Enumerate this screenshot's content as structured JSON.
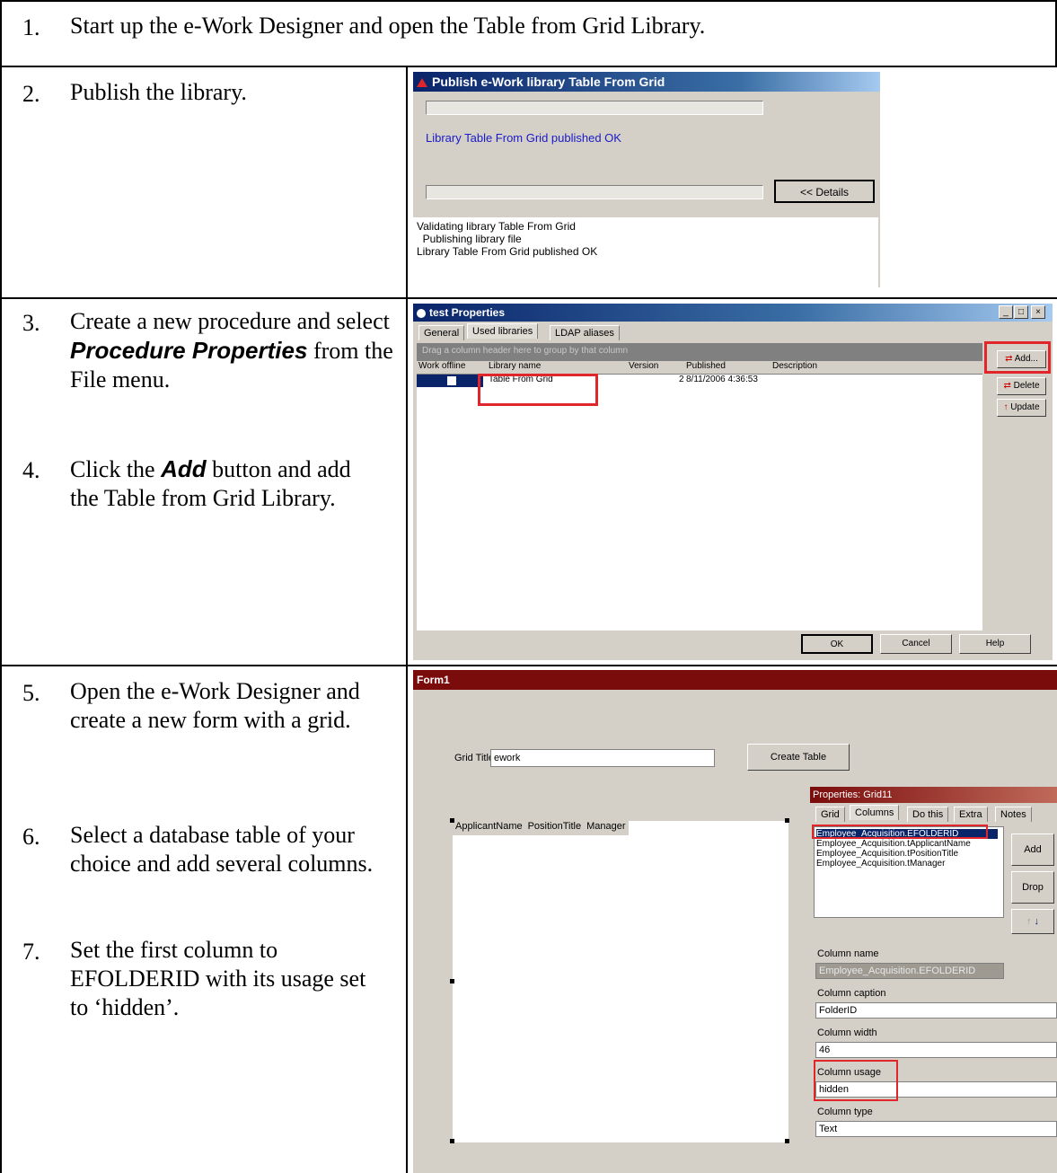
{
  "steps": [
    {
      "num": "1.",
      "text": "Start up the e-Work Designer and open the Table from Grid Library."
    },
    {
      "num": "2.",
      "text": "Publish the library."
    },
    {
      "num": "3.",
      "text_a": "Create a new procedure and select ",
      "bold": "Procedure Properties",
      "text_b": " from the File menu."
    },
    {
      "num": "4.",
      "text_a": "Click the ",
      "bold": "Add",
      "text_b": " button and add the Table from Grid Library."
    },
    {
      "num": "5.",
      "text": "Open the e-Work Designer and create a new form with a grid."
    },
    {
      "num": "6.",
      "text": "Select a database table of your choice and add several columns."
    },
    {
      "num": "7.",
      "text": "Set the first column to EFOLDERID with its usage set to ‘hidden’."
    }
  ],
  "publish_dialog": {
    "title": "Publish e-Work library Table From Grid",
    "status": "Library Table From Grid published OK",
    "details_button": "<< Details",
    "log": [
      "Validating library  Table From Grid",
      "  Publishing library file",
      "Library Table From Grid published OK"
    ]
  },
  "properties_dialog": {
    "title": "test Properties",
    "tabs": [
      "General",
      "Used libraries",
      "LDAP aliases"
    ],
    "group_hint": "Drag a column header here to group by that column",
    "columns": [
      "Work offline",
      "Library name",
      "Version",
      "Published",
      "Description"
    ],
    "row": {
      "name": "Table From Grid",
      "version": "2",
      "published": "8/11/2006 4:36:53"
    },
    "buttons": {
      "add": "Add...",
      "delete": "Delete",
      "update": "Update",
      "ok": "OK",
      "cancel": "Cancel",
      "help": "Help"
    }
  },
  "form": {
    "title": "Form1",
    "grid_title_label": "Grid Title",
    "grid_title_value": "ework",
    "create_button": "Create Table",
    "grid_headers": [
      "ApplicantName",
      "PositionTitle",
      "Manager"
    ],
    "props": {
      "title": "Properties: Grid11",
      "tabs": [
        "Grid",
        "Columns",
        "Do this",
        "Extra",
        "Notes"
      ],
      "list": [
        "Employee_Acquisition.EFOLDERID",
        "Employee_Acquisition.tApplicantName",
        "Employee_Acquisition.tPositionTitle",
        "Employee_Acquisition.tManager"
      ],
      "add": "Add",
      "drop": "Drop",
      "col_name_label": "Column name",
      "col_name_value": "Employee_Acquisition.EFOLDERID",
      "col_caption_label": "Column caption",
      "col_caption_value": "FolderID",
      "col_width_label": "Column width",
      "col_width_value": "46",
      "col_usage_label": "Column usage",
      "col_usage_value": "hidden",
      "col_type_label": "Column type",
      "col_type_value": "Text"
    }
  },
  "colors": {
    "accent_red": "#e0262a",
    "titlebar_blue": "#0a246a",
    "form_titlebar": "#7a0c0c"
  }
}
